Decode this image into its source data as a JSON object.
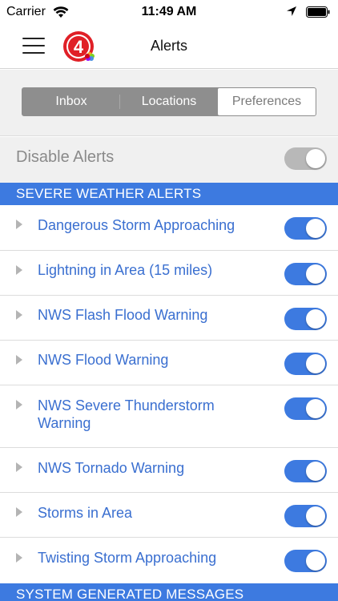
{
  "status_bar": {
    "carrier": "Carrier",
    "time": "11:49 AM"
  },
  "nav": {
    "title": "Alerts",
    "logo_text": "4"
  },
  "tabs": [
    {
      "label": "Inbox",
      "selected": false
    },
    {
      "label": "Locations",
      "selected": false
    },
    {
      "label": "Preferences",
      "selected": true
    }
  ],
  "disable_alerts": {
    "label": "Disable Alerts",
    "on": true
  },
  "sections": [
    {
      "title": "SEVERE WEATHER ALERTS",
      "items": [
        {
          "label": "Dangerous Storm Approaching",
          "on": true
        },
        {
          "label": "Lightning in Area (15 miles)",
          "on": true
        },
        {
          "label": "NWS Flash Flood Warning",
          "on": true
        },
        {
          "label": "NWS Flood Warning",
          "on": true
        },
        {
          "label": "NWS Severe Thunderstorm Warning",
          "on": true
        },
        {
          "label": "NWS Tornado Warning",
          "on": true
        },
        {
          "label": "Storms in Area",
          "on": true
        },
        {
          "label": "Twisting Storm Approaching",
          "on": true
        }
      ]
    },
    {
      "title": "SYSTEM GENERATED MESSAGES",
      "items": []
    }
  ],
  "colors": {
    "accent": "#3d7ae0",
    "label_blue": "#3a6fd0",
    "toggle_on": "#3d7ae0",
    "toggle_disabled": "#b8b8b8",
    "segment_bg": "#8e8e8e"
  },
  "icons": {
    "wifi": "wifi-icon",
    "location": "location-arrow-icon",
    "battery": "battery-icon",
    "menu": "hamburger-menu-icon",
    "chevron": "chevron-right-icon"
  }
}
